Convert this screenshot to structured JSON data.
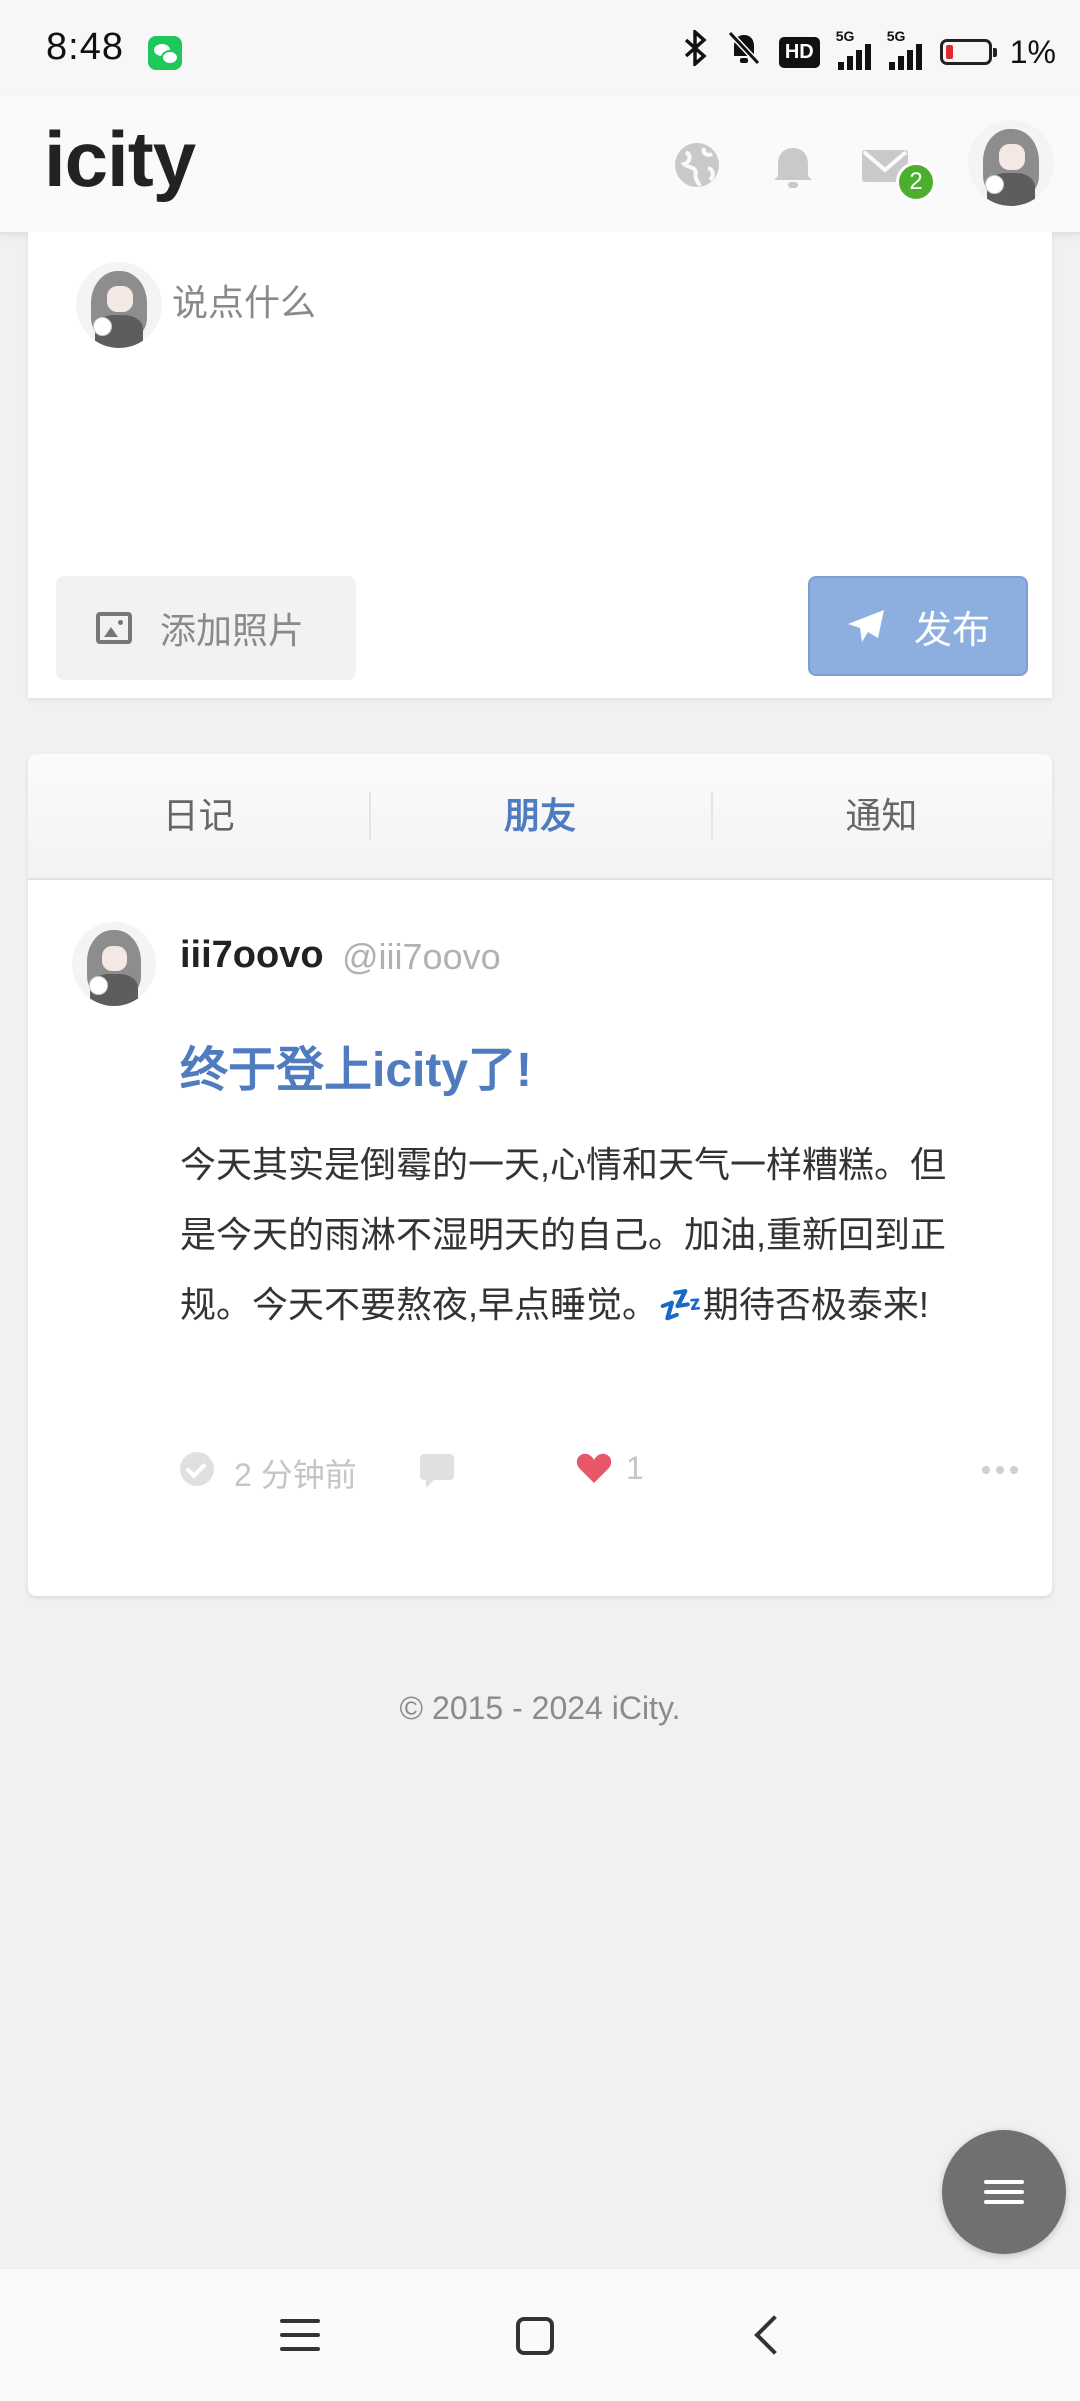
{
  "status_bar": {
    "time": "8:48",
    "network_hd": "HD",
    "network_5g_1": "5G",
    "network_5g_2": "5G",
    "battery": "1%",
    "icons": [
      "wechat-icon",
      "bluetooth-icon",
      "mute-icon",
      "signal-icon",
      "battery-icon"
    ]
  },
  "header": {
    "logo": "icity",
    "mail_badge": "2",
    "icons": [
      "globe-icon",
      "bell-icon",
      "mail-icon"
    ]
  },
  "composer": {
    "placeholder": "说点什么",
    "add_photo_label": "添加照片",
    "publish_label": "发布"
  },
  "tabs": [
    {
      "label": "日记",
      "active": false
    },
    {
      "label": "朋友",
      "active": true
    },
    {
      "label": "通知",
      "active": false
    }
  ],
  "post": {
    "author": "iii7oovo",
    "handle": "@iii7oovo",
    "title": "终于登上icity了!",
    "body": "今天其实是倒霉的一天,心情和天气一样糟糕。但是今天的雨淋不湿明天的自己。加油,重新回到正规。今天不要熬夜,早点睡觉。💤期待否极泰来!",
    "time": "2 分钟前",
    "likes": "1"
  },
  "footer": {
    "copyright": "© 2015 - 2024 iCity."
  },
  "colors": {
    "accent": "#4f7bbf",
    "publish_button": "#8cafe0",
    "badge": "#4cae2d",
    "heart": "#e8566a"
  }
}
